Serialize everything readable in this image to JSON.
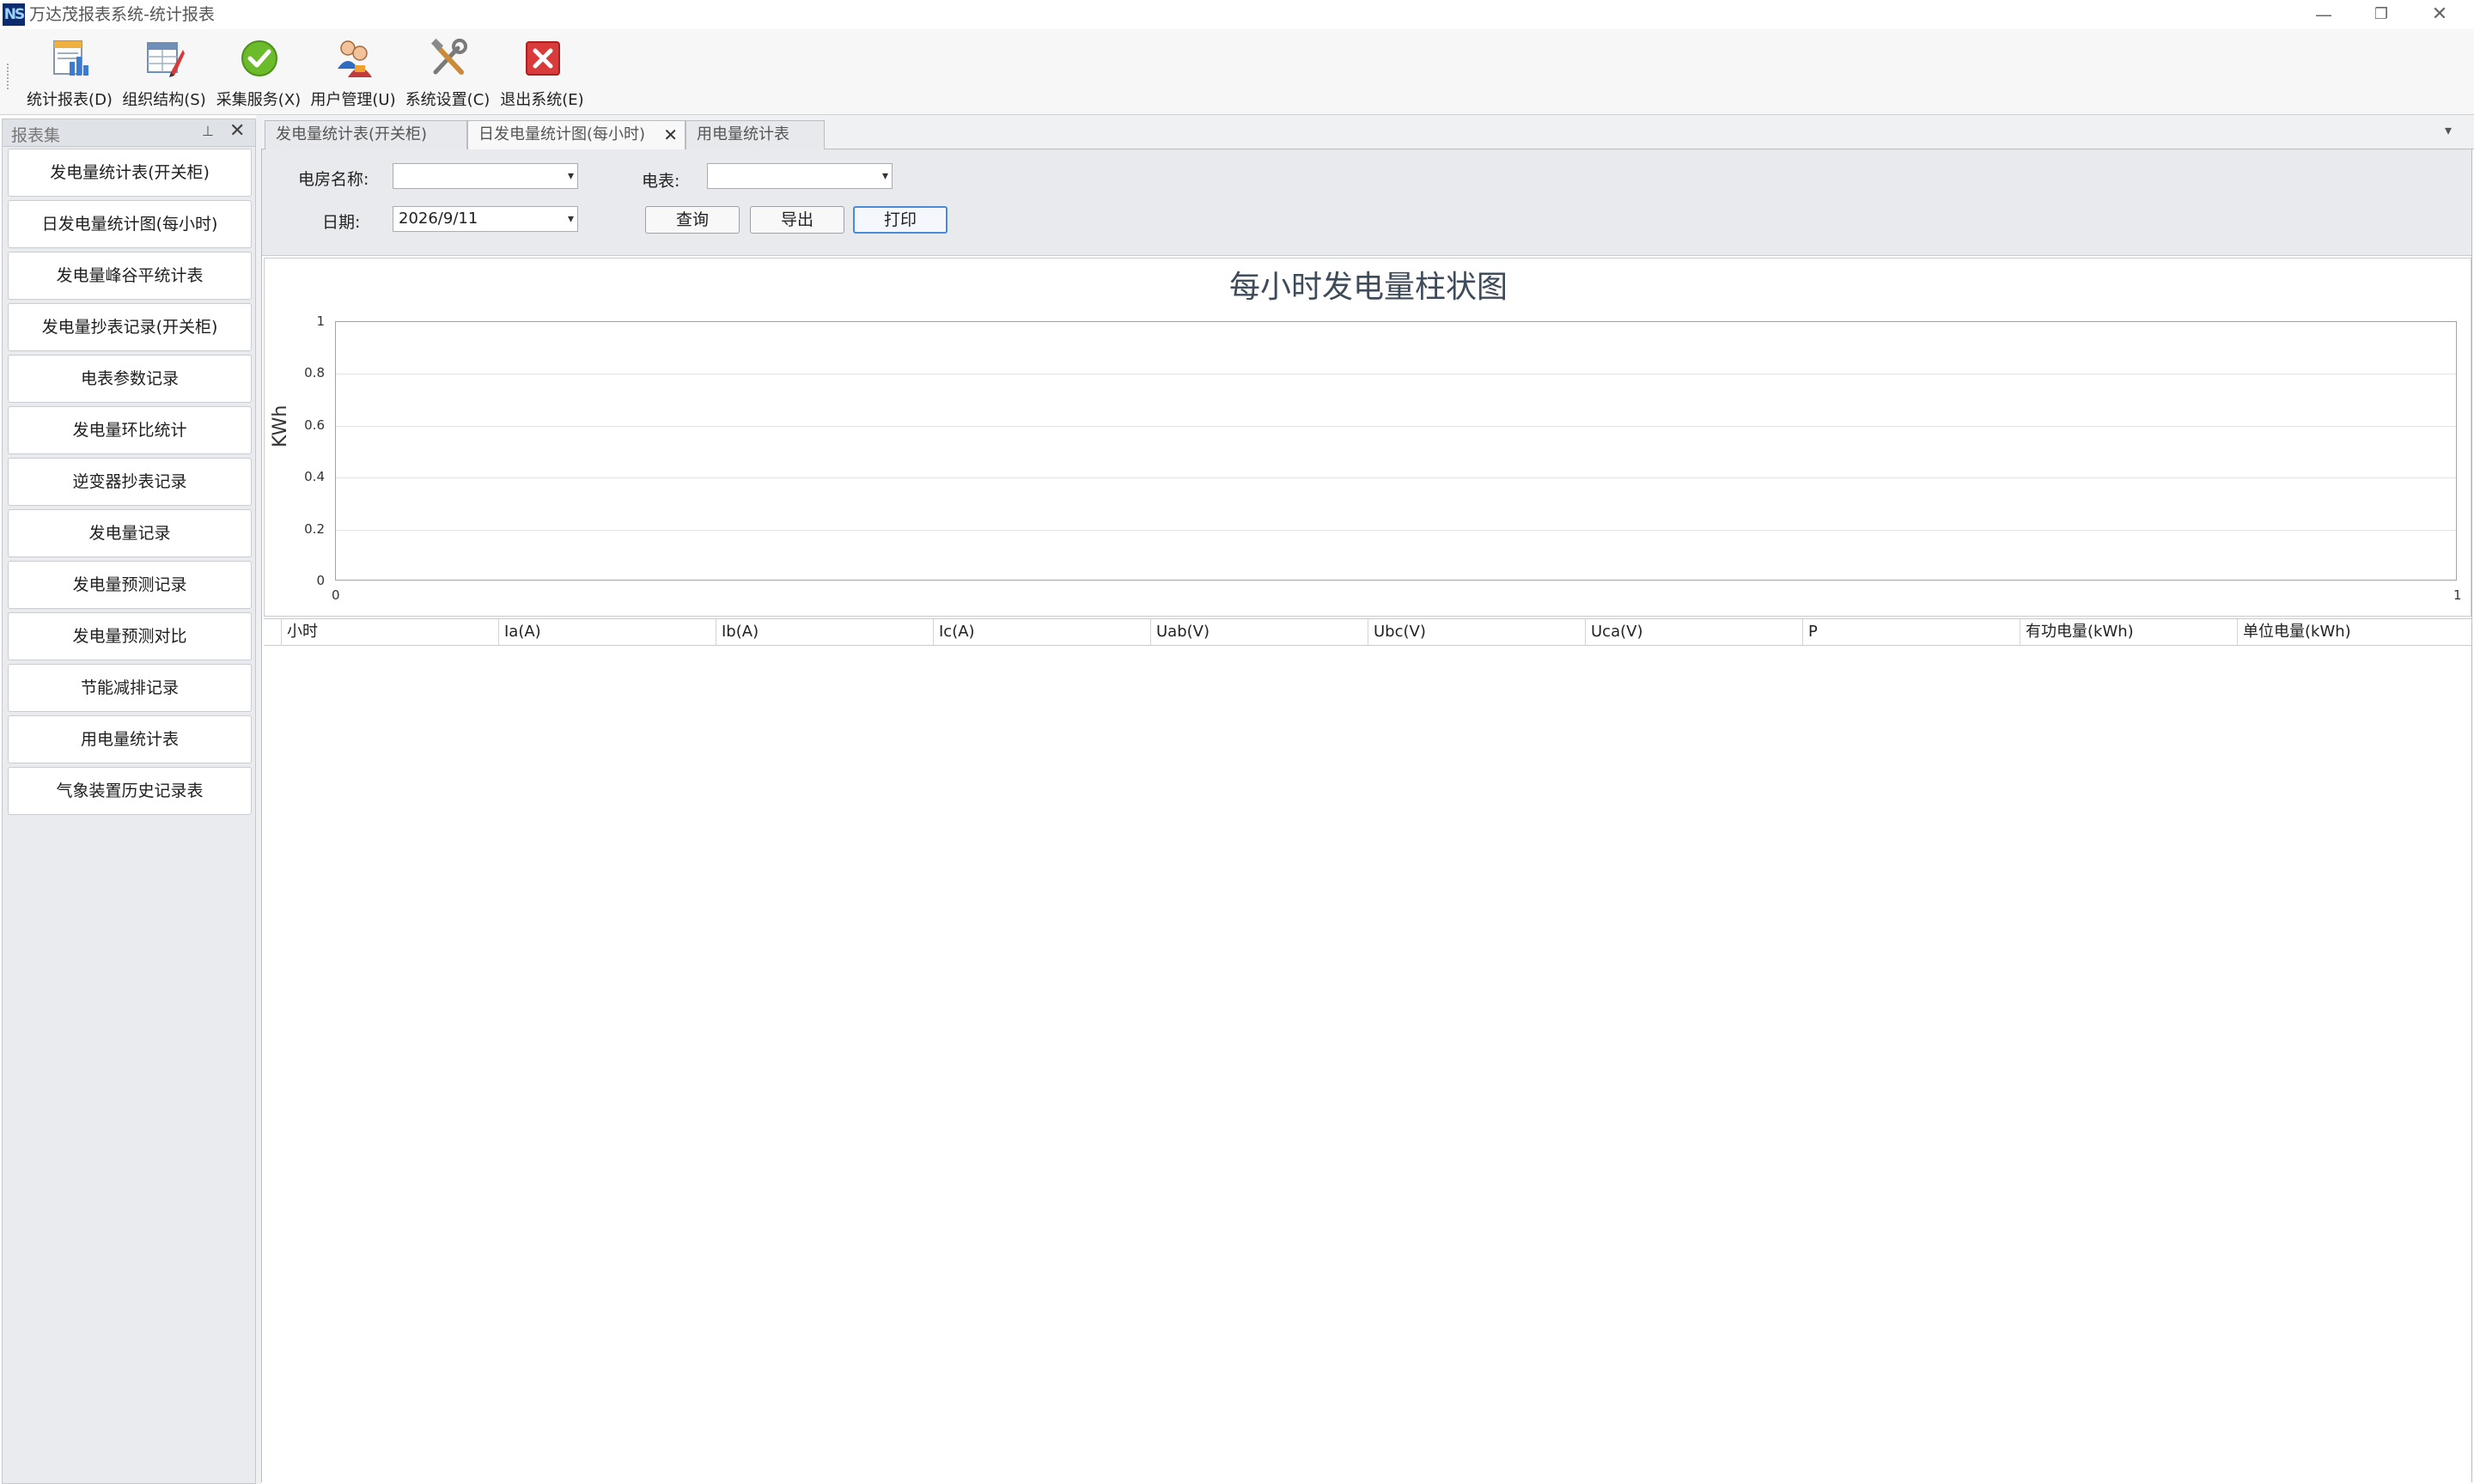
{
  "window": {
    "icon_text": "NS",
    "title": "万达茂报表系统-统计报表",
    "minimize": "—",
    "maximize": "❐",
    "close": "✕"
  },
  "toolbar": {
    "items": [
      {
        "label": "统计报表(D)",
        "icon": "report-chart-icon"
      },
      {
        "label": "组织结构(S)",
        "icon": "org-structure-icon"
      },
      {
        "label": "采集服务(X)",
        "icon": "checkmark-service-icon"
      },
      {
        "label": "用户管理(U)",
        "icon": "users-icon"
      },
      {
        "label": "系统设置(C)",
        "icon": "tools-icon"
      },
      {
        "label": "退出系统(E)",
        "icon": "exit-icon"
      }
    ]
  },
  "sidebar": {
    "title": "报表集",
    "pin": "⊥",
    "close": "✕",
    "items": [
      {
        "label": "发电量统计表(开关柜)"
      },
      {
        "label": "日发电量统计图(每小时)"
      },
      {
        "label": "发电量峰谷平统计表"
      },
      {
        "label": "发电量抄表记录(开关柜)"
      },
      {
        "label": "电表参数记录"
      },
      {
        "label": "发电量环比统计"
      },
      {
        "label": "逆变器抄表记录"
      },
      {
        "label": "发电量记录"
      },
      {
        "label": "发电量预测记录"
      },
      {
        "label": "发电量预测对比"
      },
      {
        "label": "节能减排记录"
      },
      {
        "label": "用电量统计表"
      },
      {
        "label": "气象装置历史记录表"
      }
    ]
  },
  "tabs": {
    "items": [
      {
        "label": "发电量统计表(开关柜)"
      },
      {
        "label": "日发电量统计图(每小时)"
      },
      {
        "label": "用电量统计表"
      }
    ],
    "active_index": 1,
    "close": "✕",
    "dropdown": "▾"
  },
  "filters": {
    "room_label": "电房名称:",
    "room_value": "",
    "meter_label": "电表:",
    "meter_value": "",
    "date_label": "日期:",
    "date_value": "2026/9/11",
    "arrow": "▾",
    "query_button": "查询",
    "export_button": "导出",
    "print_button": "打印"
  },
  "chart_data": {
    "type": "bar",
    "title": "每小时发电量柱状图",
    "ylabel": "KWh",
    "xlabel": "",
    "ylim": [
      0,
      1
    ],
    "xlim": [
      0,
      1
    ],
    "yticks": [
      "1",
      "0.8",
      "0.6",
      "0.4",
      "0.2",
      "0"
    ],
    "xticks": [
      "0",
      "1"
    ],
    "series": [],
    "grid": true
  },
  "table": {
    "columns": [
      "小时",
      "Ia(A)",
      "Ib(A)",
      "Ic(A)",
      "Uab(V)",
      "Ubc(V)",
      "Uca(V)",
      "P",
      "有功电量(kWh)",
      "单位电量(kWh)"
    ],
    "rows": []
  }
}
